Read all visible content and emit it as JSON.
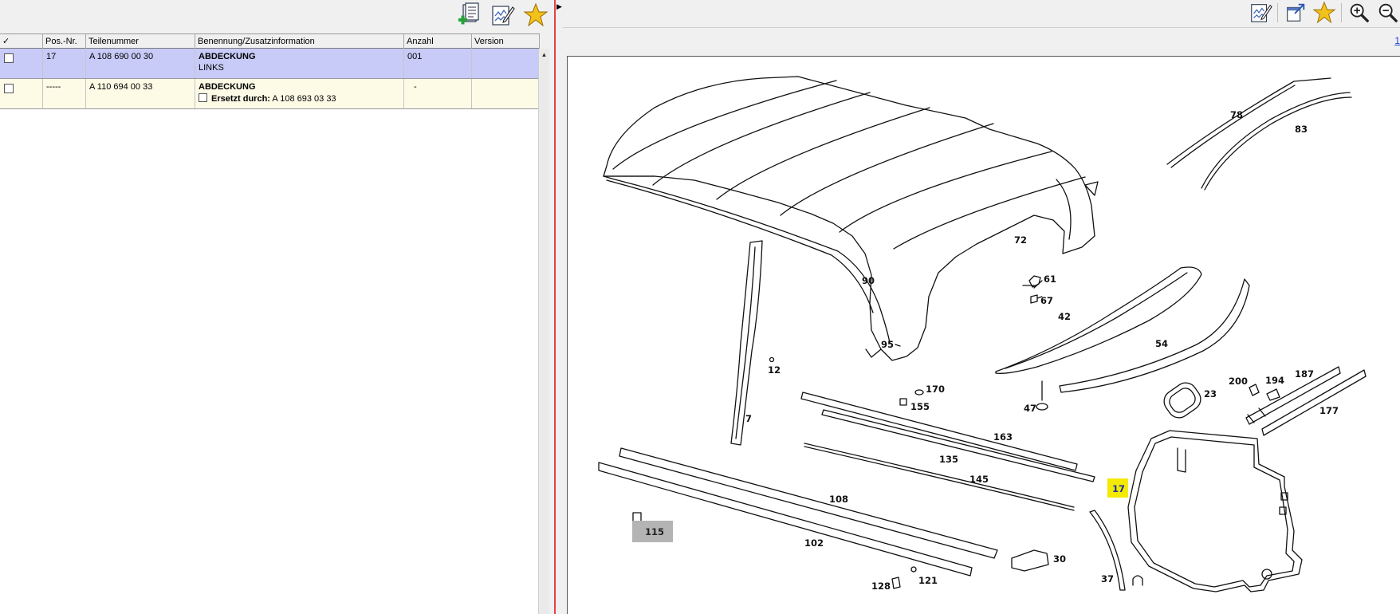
{
  "left_toolbar": {
    "icons": [
      "add-to-list-icon",
      "edit-note-icon",
      "favorite-star-icon"
    ]
  },
  "table": {
    "headers": {
      "check": "✓",
      "pos": "Pos.-Nr.",
      "part_no": "Teilenummer",
      "desc": "Benennung/Zusatzinformation",
      "qty": "Anzahl",
      "version": "Version"
    },
    "rows": [
      {
        "pos": "17",
        "part_no": "A 108 690 00 30",
        "desc": "ABDECKUNG",
        "desc2": "LINKS",
        "qty": "001",
        "version": "",
        "selected": true
      },
      {
        "pos": "-----",
        "part_no": "A 110 694 00 33",
        "desc": "ABDECKUNG",
        "replaced_label": "Ersetzt durch:",
        "replaced_value": "A 108 693 03 33",
        "qty": "-",
        "version": ""
      }
    ]
  },
  "right_toolbar": {
    "icons": [
      "edit-note-icon",
      "export-window-icon",
      "favorite-star-icon",
      "zoom-in-icon",
      "zoom-out-icon"
    ],
    "page_link": "1"
  },
  "colors": {
    "selected_row": "#c8cbf8",
    "replacement_row": "#fdfae6",
    "highlight_callout": "#f3ea00",
    "splitter_line": "#e84040"
  },
  "diagram": {
    "callouts": [
      "78",
      "83",
      "72",
      "61",
      "67",
      "90",
      "42",
      "95",
      "54",
      "12",
      "170",
      "155",
      "47",
      "23",
      "200",
      "194",
      "187",
      "163",
      "7",
      "135",
      "177",
      "145",
      "17",
      "108",
      "115",
      "102",
      "30",
      "37",
      "128",
      "121"
    ],
    "selected_callout": "17",
    "gray_callout": "115"
  }
}
